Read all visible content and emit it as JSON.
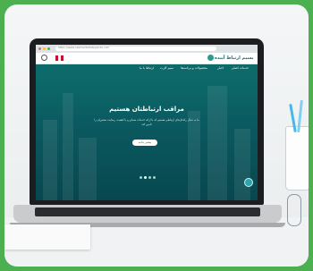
{
  "browser": {
    "url": "https://www.nasimertebatayande.com"
  },
  "site": {
    "logo_text": "نسیم ارتباط آینده",
    "nav": [
      {
        "label": "خدمات اصلی"
      },
      {
        "label": "اخبار"
      },
      {
        "label": "محصولات و برنامه‌ها"
      },
      {
        "label": "سیم کارت"
      },
      {
        "label": "ارتباط با ما"
      }
    ],
    "hero_title": "مراقب ارتباطتان هستیم",
    "hero_text": "ما به دنبال راه‌حل‌های ارتباطی هستیم که با ارائه خدمات متمایز و با کیفیت، رضایت مشتریان را تامین کند",
    "hero_button": "بیشتر بدانید",
    "slider_dots": 4
  },
  "colors": {
    "brand": "#0d6a6a",
    "accent": "#2aa6b0",
    "frame": "#4caf50"
  },
  "icons": {
    "search": "search-icon",
    "flag": "uk-flag-icon",
    "chat": "chat-icon"
  }
}
